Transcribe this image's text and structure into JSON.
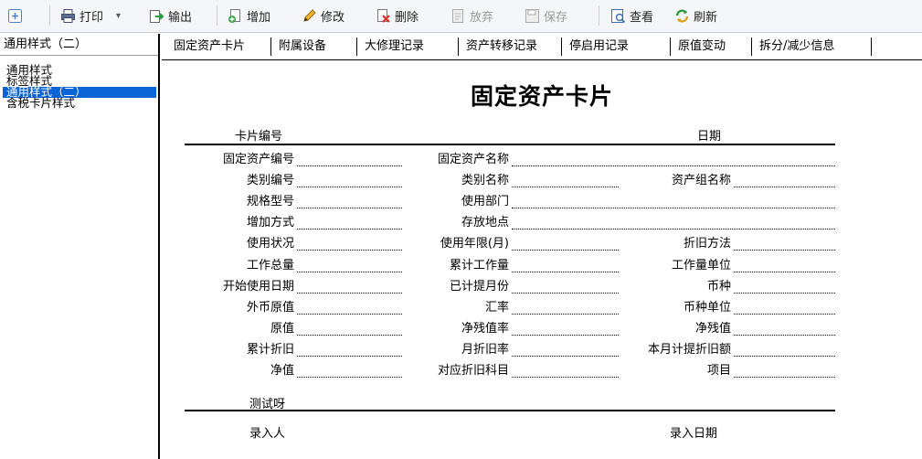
{
  "toolbar": {
    "buttons": [
      {
        "name": "add-box-button",
        "label": "",
        "icon": "plus-box-icon",
        "disabled": false
      },
      {
        "name": "print-button",
        "label": "打印",
        "icon": "printer-icon",
        "disabled": false
      },
      {
        "name": "export-button",
        "label": "输出",
        "icon": "export-icon",
        "disabled": false
      },
      {
        "name": "add-button",
        "label": "增加",
        "icon": "add-document-icon",
        "disabled": false
      },
      {
        "name": "edit-button",
        "label": "修改",
        "icon": "pencil-icon",
        "disabled": false
      },
      {
        "name": "delete-button",
        "label": "删除",
        "icon": "delete-icon",
        "disabled": false
      },
      {
        "name": "discard-button",
        "label": "放弃",
        "icon": "discard-icon",
        "disabled": true
      },
      {
        "name": "save-button",
        "label": "保存",
        "icon": "save-icon",
        "disabled": true
      },
      {
        "name": "view-button",
        "label": "查看",
        "icon": "view-icon",
        "disabled": false
      },
      {
        "name": "refresh-button",
        "label": "刷新",
        "icon": "refresh-icon",
        "disabled": false
      }
    ]
  },
  "style_panel": {
    "selected": "通用样式（二）",
    "items": [
      "通用样式",
      "标签样式",
      "通用样式（二）",
      "含税卡片样式"
    ],
    "selected_index": 2
  },
  "tabs": [
    "固定资产卡片",
    "附属设备",
    "大修理记录",
    "资产转移记录",
    "停启用记录",
    "原值变动",
    "拆分/减少信息"
  ],
  "card": {
    "title": "固定资产卡片",
    "header_left": "卡片编号",
    "header_right": "日期",
    "fields": [
      [
        "固定资产编号",
        "固定资产名称"
      ],
      [
        "类别编号",
        "类别名称",
        "资产组名称"
      ],
      [
        "规格型号",
        "使用部门"
      ],
      [
        "增加方式",
        "存放地点"
      ],
      [
        "使用状况",
        "使用年限(月)",
        "折旧方法"
      ],
      [
        "工作总量",
        "累计工作量",
        "工作量单位"
      ],
      [
        "开始使用日期",
        "已计提月份",
        "币种"
      ],
      [
        "外币原值",
        "汇率",
        "币种单位"
      ],
      [
        "原值",
        "净残值率",
        "净残值"
      ],
      [
        "累计折旧",
        "月折旧率",
        "本月计提折旧额"
      ],
      [
        "净值",
        "对应折旧科目",
        "项目"
      ]
    ],
    "extra_label": "测试呀",
    "footer_left": "录入人",
    "footer_right": "录入日期"
  },
  "colors": {
    "selection": "#0a64d6",
    "toolbar_bg": "#f4f6f9"
  }
}
